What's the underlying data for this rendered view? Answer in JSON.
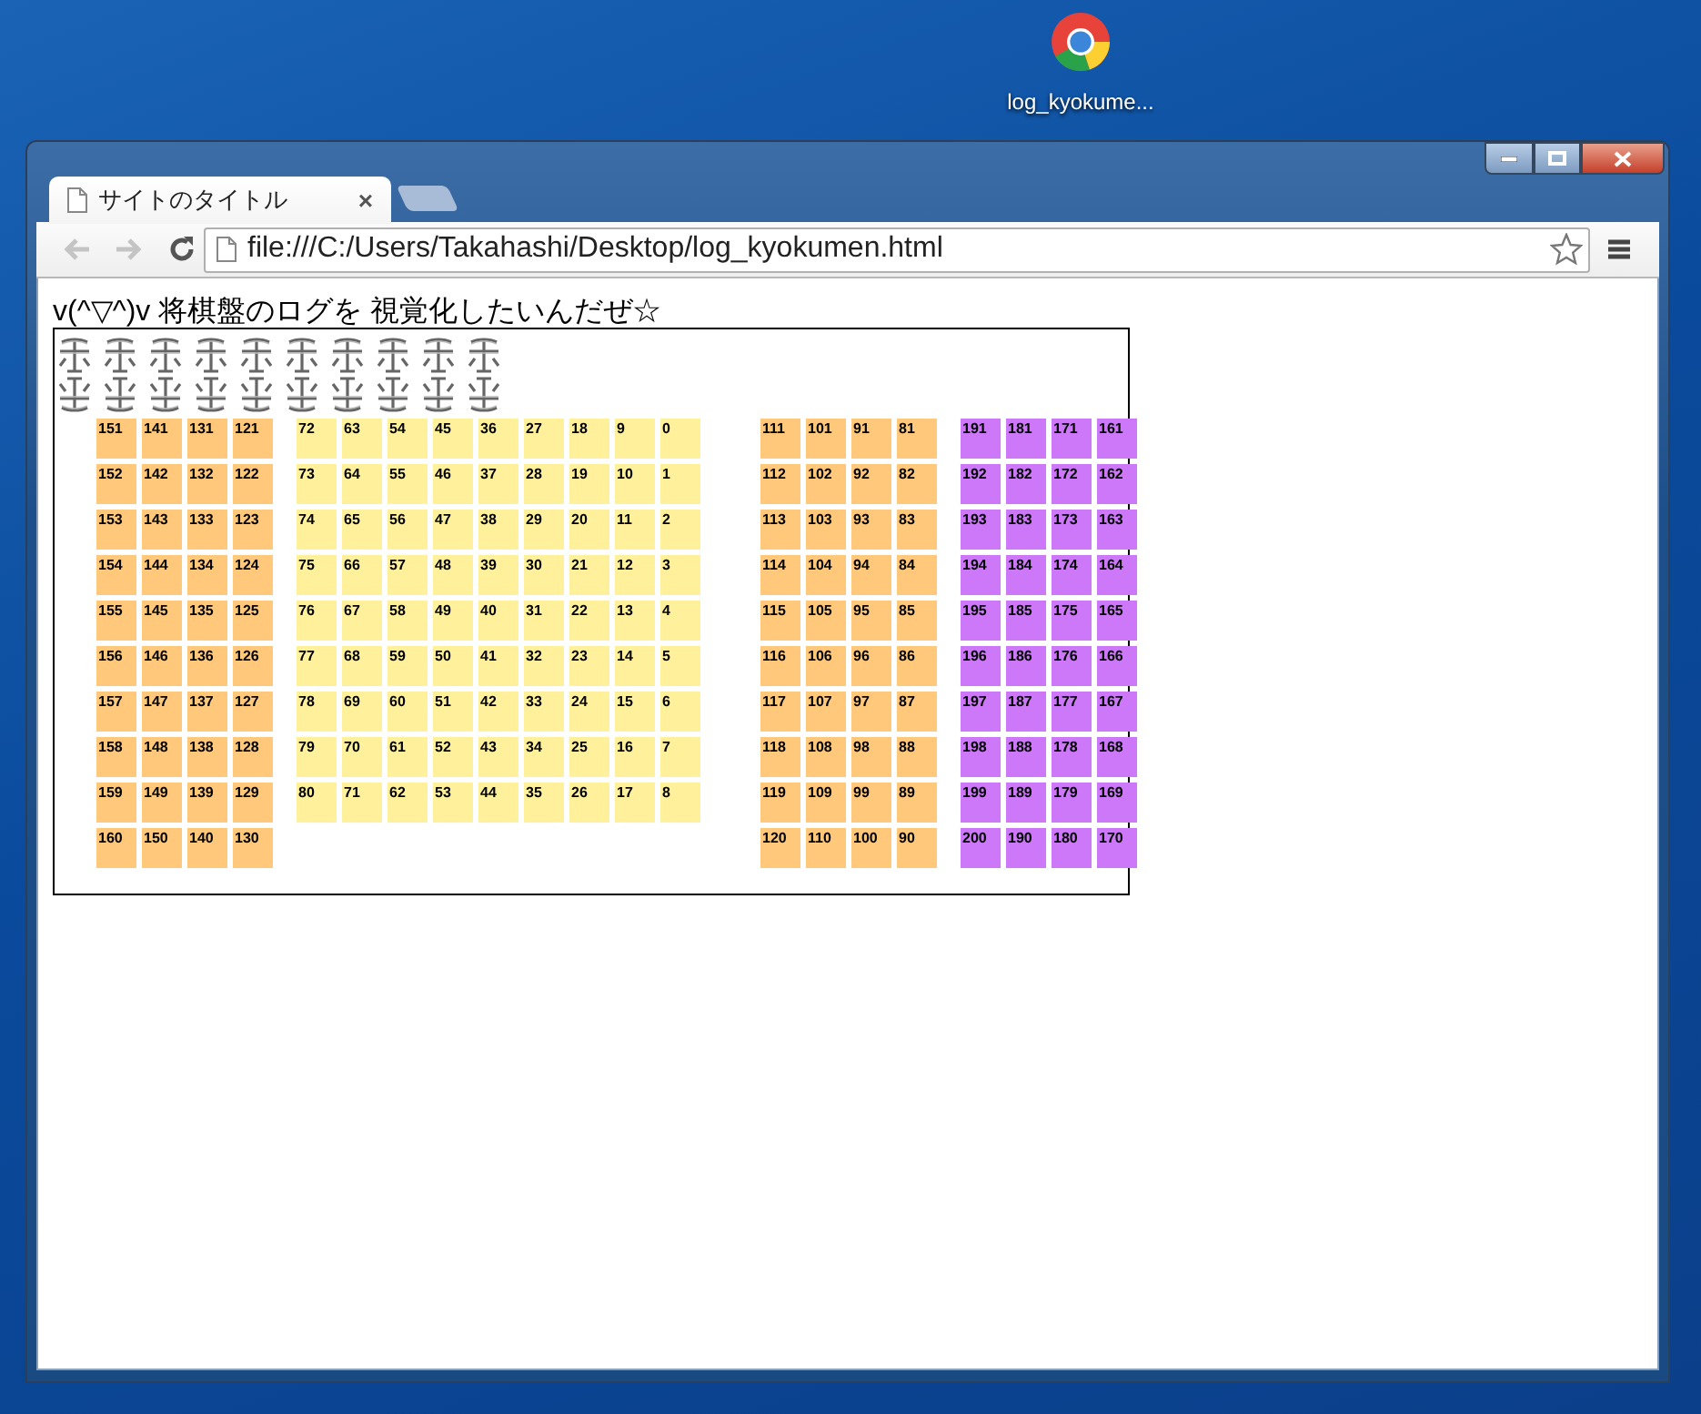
{
  "desktop_icon": {
    "label": "log_kyokume..."
  },
  "tabs": [
    {
      "title": "サイトのタイトル",
      "close": "×",
      "selected": true
    }
  ],
  "address_bar": {
    "url": "file:///C:/Users/Takahashi/Desktop/log_kyokumen.html"
  },
  "page": {
    "heading": "v(^▽^)v  将棋盤のログを  視覚化したいんだぜ☆",
    "pieces": [
      {
        "upside_down": false
      },
      {
        "upside_down": false
      },
      {
        "upside_down": false
      },
      {
        "upside_down": false
      },
      {
        "upside_down": false
      },
      {
        "upside_down": false
      },
      {
        "upside_down": false
      },
      {
        "upside_down": false
      },
      {
        "upside_down": false
      },
      {
        "upside_down": false
      },
      {
        "upside_down": true
      },
      {
        "upside_down": true
      },
      {
        "upside_down": true
      },
      {
        "upside_down": true
      },
      {
        "upside_down": true
      },
      {
        "upside_down": true
      },
      {
        "upside_down": true
      },
      {
        "upside_down": true
      },
      {
        "upside_down": true
      },
      {
        "upside_down": true
      }
    ],
    "blocks": [
      {
        "color": "#ffc87a",
        "columns": [
          [
            "151",
            "152",
            "153",
            "154",
            "155",
            "156",
            "157",
            "158",
            "159",
            "160"
          ],
          [
            "141",
            "142",
            "143",
            "144",
            "145",
            "146",
            "147",
            "148",
            "149",
            "150"
          ],
          [
            "131",
            "132",
            "133",
            "134",
            "135",
            "136",
            "137",
            "138",
            "139",
            "140"
          ],
          [
            "121",
            "122",
            "123",
            "124",
            "125",
            "126",
            "127",
            "128",
            "129",
            "130"
          ]
        ]
      },
      {
        "color": "#fff09c",
        "columns": [
          [
            "72",
            "73",
            "74",
            "75",
            "76",
            "77",
            "78",
            "79",
            "80"
          ],
          [
            "63",
            "64",
            "65",
            "66",
            "67",
            "68",
            "69",
            "70",
            "71"
          ],
          [
            "54",
            "55",
            "56",
            "57",
            "58",
            "59",
            "60",
            "61",
            "62"
          ],
          [
            "45",
            "46",
            "47",
            "48",
            "49",
            "50",
            "51",
            "52",
            "53"
          ],
          [
            "36",
            "37",
            "38",
            "39",
            "40",
            "41",
            "42",
            "43",
            "44"
          ],
          [
            "27",
            "28",
            "29",
            "30",
            "31",
            "32",
            "33",
            "34",
            "35"
          ],
          [
            "18",
            "19",
            "20",
            "21",
            "22",
            "23",
            "24",
            "25",
            "26"
          ],
          [
            "9",
            "10",
            "11",
            "12",
            "13",
            "14",
            "15",
            "16",
            "17"
          ],
          [
            "0",
            "1",
            "2",
            "3",
            "4",
            "5",
            "6",
            "7",
            "8"
          ]
        ]
      },
      {
        "color": "#ffc87a",
        "columns": [
          [
            "111",
            "112",
            "113",
            "114",
            "115",
            "116",
            "117",
            "118",
            "119",
            "120"
          ],
          [
            "101",
            "102",
            "103",
            "104",
            "105",
            "106",
            "107",
            "108",
            "109",
            "110"
          ],
          [
            "91",
            "92",
            "93",
            "94",
            "95",
            "96",
            "97",
            "98",
            "99",
            "100"
          ],
          [
            "81",
            "82",
            "83",
            "84",
            "85",
            "86",
            "87",
            "88",
            "89",
            "90"
          ]
        ]
      },
      {
        "color": "#cc78f8",
        "columns": [
          [
            "191",
            "192",
            "193",
            "194",
            "195",
            "196",
            "197",
            "198",
            "199",
            "200"
          ],
          [
            "181",
            "182",
            "183",
            "184",
            "185",
            "186",
            "187",
            "188",
            "189",
            "190"
          ],
          [
            "171",
            "172",
            "173",
            "174",
            "175",
            "176",
            "177",
            "178",
            "179",
            "180"
          ],
          [
            "161",
            "162",
            "163",
            "164",
            "165",
            "166",
            "167",
            "168",
            "169",
            "170"
          ]
        ]
      }
    ]
  }
}
